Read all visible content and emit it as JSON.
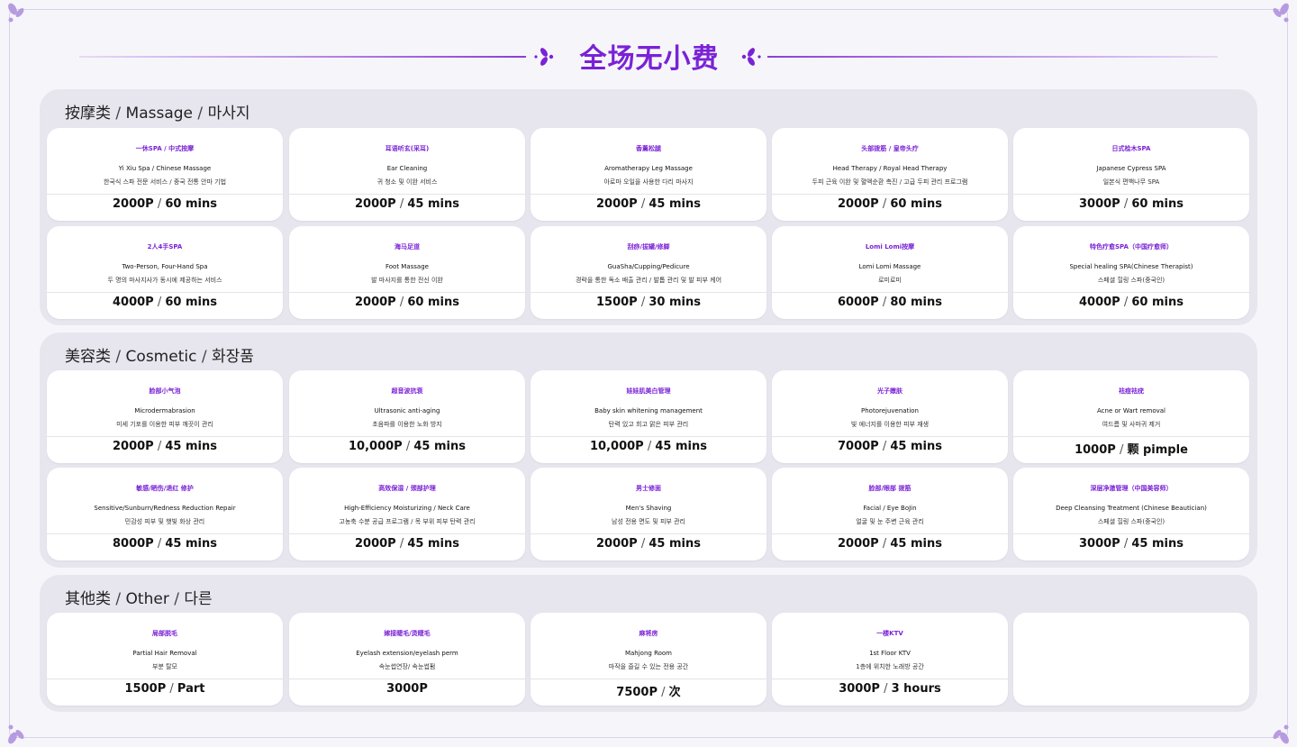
{
  "header": {
    "title": "全场无小费"
  },
  "colors": {
    "accent": "#7a22d6",
    "section_bg": "#e7e6ef",
    "card_bg": "#ffffff"
  },
  "sections": [
    {
      "title_zh": "按摩类",
      "title_en": "Massage",
      "title_ko": "마사지",
      "cards": [
        {
          "name": "一休SPA / 中式按摩",
          "en": "Yi Xiu Spa / Chinese Massage",
          "ko": "한국식 스파 전문 서비스 / 중국 전통 안마 기법",
          "price": "2000P",
          "duration": "60 mins"
        },
        {
          "name": "耳语听玄(采耳)",
          "en": "Ear Cleaning",
          "ko": "귀 청소 및 이완 서비스",
          "price": "2000P",
          "duration": "45 mins"
        },
        {
          "name": "香薰松腿",
          "en": "Aromatherapy Leg Massage",
          "ko": "아로마 오일을 사용한 다리 마사지",
          "price": "2000P",
          "duration": "45 mins"
        },
        {
          "name": "头部拨筋 / 皇帝头疗",
          "en": "Head Therapy / Royal Head Therapy",
          "ko": "두피 근육 이완 및 혈액순환 촉진 / 고급 두피 관리 프로그램",
          "price": "2000P",
          "duration": "60 mins"
        },
        {
          "name": "日式桧木SPA",
          "en": "Japanese Cypress SPA",
          "ko": "일본식 편백나무 SPA",
          "price": "3000P",
          "duration": "60 mins"
        },
        {
          "name": "2人4手SPA",
          "en": "Two-Person, Four-Hand Spa",
          "ko": "두 명의 마사지사가 동시에 제공하는 서비스",
          "price": "4000P",
          "duration": "60 mins"
        },
        {
          "name": "海马足道",
          "en": "Foot Massage",
          "ko": "발 마사지를 통한 전신 이완",
          "price": "2000P",
          "duration": "60 mins"
        },
        {
          "name": "刮痧/拔罐/修脚",
          "en": "GuaSha/Cupping/Pedicure",
          "ko": "경락을 통한 독소 배출 관리 / 발톱 관리 및 발 피부 케어",
          "price": "1500P",
          "duration": "30 mins"
        },
        {
          "name": "Lomi Lomi按摩",
          "en": "Lomi Lomi Massage",
          "ko": "로미로미",
          "price": "6000P",
          "duration": "80 mins"
        },
        {
          "name": "特色疗愈SPA（中国疗愈师）",
          "en": "Special healing SPA(Chinese Therapist)",
          "ko": "스페셜 힐링 스파(중국인)",
          "price": "4000P",
          "duration": "60 mins"
        }
      ]
    },
    {
      "title_zh": "美容类",
      "title_en": "Cosmetic",
      "title_ko": "화장품",
      "cards": [
        {
          "name": "脸部小气泡",
          "en": "Microdermabrasion",
          "ko": "미세 기포를 이용한 피부 깨끗이 관리",
          "price": "2000P",
          "duration": "45 mins"
        },
        {
          "name": "超音波抗衰",
          "en": "Ultrasonic anti-aging",
          "ko": "초음파를 이용한 노화 방지",
          "price": "10,000P",
          "duration": "45 mins"
        },
        {
          "name": "娃娃肌美白管理",
          "en": "Baby skin whitening management",
          "ko": "탄력 있고 희고 맑은 피부 관리",
          "price": "10,000P",
          "duration": "45 mins"
        },
        {
          "name": "光子嫩肤",
          "en": "Photorejuvenation",
          "ko": "빛 에너지를 이용한 피부 재생",
          "price": "7000P",
          "duration": "45 mins"
        },
        {
          "name": "祛痘祛疣",
          "en": "Acne or Wart  removal",
          "ko": "여드름 및 사마귀 제거",
          "price": "1000P",
          "duration": "颗 pimple"
        },
        {
          "name": "敏感/晒伤/退红 修护",
          "en": "Sensitive/Sunburn/Redness Reduction Repair",
          "ko": "민감성 피부 및 햇빛 화상 관리",
          "price": "8000P",
          "duration": "45 mins"
        },
        {
          "name": "高效保湿 / 颈部护理",
          "en": "High-Efficiency Moisturizing / Neck Care",
          "ko": "고농축 수분 공급 프로그램 / 목 부위 피부 탄력 관리",
          "price": "2000P",
          "duration": "45 mins"
        },
        {
          "name": "男士修面",
          "en": "Men's Shaving",
          "ko": "남성 전용 면도 및 피부 관리",
          "price": "2000P",
          "duration": "45 mins"
        },
        {
          "name": "脸部/眼部 拨筋",
          "en": "Facial / Eye  BoJin",
          "ko": "얼굴 및 눈 주변 근육 관리",
          "price": "2000P",
          "duration": "45 mins"
        },
        {
          "name": "深层净澈管理（中国美容师）",
          "en": "Deep Cleansing Treatment (Chinese Beautician)",
          "ko": "스페셜 힐링 스파(중국인)",
          "price": "3000P",
          "duration": "45 mins"
        }
      ]
    },
    {
      "title_zh": "其他类",
      "title_en": "Other",
      "title_ko": "다른",
      "cards": [
        {
          "name": "局部脱毛",
          "en": "Partial Hair Removal",
          "ko": "부분 탈모",
          "price": "1500P",
          "duration": "Part"
        },
        {
          "name": "嫁接睫毛/烫睫毛",
          "en": "Eyelash extension/eyelash perm",
          "ko": "속눈썹연장/ 속눈썹펌",
          "price": "3000P",
          "duration": ""
        },
        {
          "name": "麻将房",
          "en": "Mahjong Room",
          "ko": "마작을 즐길 수 있는 전용 공간",
          "price": "7500P",
          "duration": "次"
        },
        {
          "name": "一楼KTV",
          "en": "1st Floor KTV",
          "ko": "1층에 위치한 노래방 공간",
          "price": "3000P",
          "duration": "3 hours"
        },
        {
          "name": "",
          "en": "",
          "ko": "",
          "price": "",
          "duration": ""
        }
      ]
    }
  ]
}
